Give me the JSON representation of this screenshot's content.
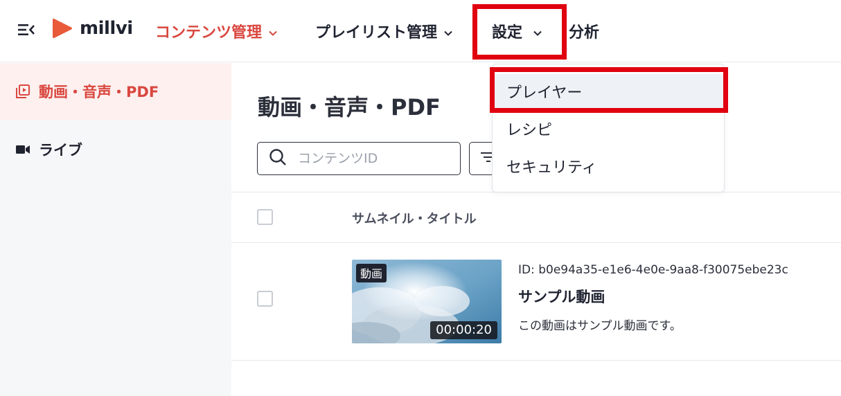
{
  "header": {
    "logo_text": "millvi",
    "nav": {
      "content": "コンテンツ管理",
      "playlist": "プレイリスト管理",
      "settings": "設定",
      "analytics": "分析"
    }
  },
  "sidebar": {
    "items": [
      {
        "label": "動画・音声・PDF",
        "icon": "video-library-icon",
        "active": true
      },
      {
        "label": "ライブ",
        "icon": "video-camera-icon",
        "active": false
      }
    ]
  },
  "main": {
    "title": "動画・音声・PDF",
    "search": {
      "placeholder": "コンテンツID",
      "value": ""
    },
    "table": {
      "column_header": "サムネイル・タイトル",
      "rows": [
        {
          "badge": "動画",
          "duration": "00:00:20",
          "id": "ID: b0e94a35-e1e6-4e0e-9aa8-f30075ebe23c",
          "title": "サンプル動画",
          "description": "この動画はサンプル動画です。"
        }
      ]
    }
  },
  "dropdown": {
    "items": [
      "プレイヤー",
      "レシピ",
      "セキュリティ"
    ]
  },
  "colors": {
    "accent": "#d9473f",
    "highlight": "#e0000f",
    "sidebar_bg": "#f6f7f9",
    "sidebar_active_bg": "#fdf0ef"
  }
}
